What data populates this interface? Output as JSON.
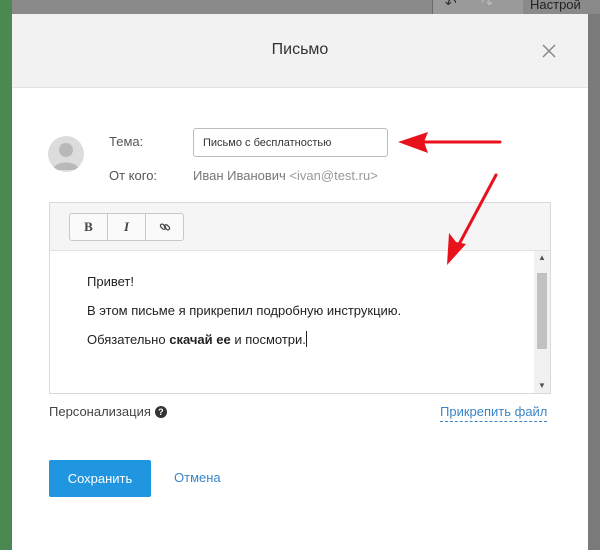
{
  "background": {
    "toolbar_undo_icon": "undo-arrow-icon",
    "toolbar_redo_icon": "redo-arrow-icon",
    "settings_label": "Настрой"
  },
  "modal": {
    "title": "Письмо",
    "close_icon": "close-icon"
  },
  "form": {
    "subject_label": "Тема:",
    "subject_value": "Письмо с бесплатностью",
    "from_label": "От кого:",
    "from_name": "Иван Иванович",
    "from_email": "ivan@test.ru"
  },
  "editor": {
    "toolbar": {
      "bold_label": "B",
      "italic_label": "I",
      "link_icon": "link-icon"
    },
    "body": {
      "line1": "Привет!",
      "line2": "В этом письме я прикрепил подробную инструкцию.",
      "line3_before": "Обязательно",
      "line3_bold": "скачай ее",
      "line3_after": "и посмотри."
    }
  },
  "footer": {
    "personalization_label": "Персонализация",
    "help_icon_glyph": "?",
    "attach_label": "Прикрепить файл",
    "save_label": "Сохранить",
    "cancel_label": "Отмена"
  },
  "colors": {
    "accent": "#2196e0",
    "link": "#3a86c8",
    "annotation_arrow": "#e8121c"
  }
}
